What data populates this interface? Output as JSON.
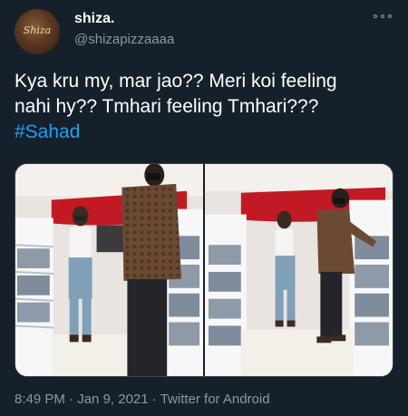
{
  "user": {
    "display_name": "shiza.",
    "handle": "@shizapizzaaaa",
    "avatar_text": "Shiza",
    "more_icon": "more-horizontal-icon"
  },
  "tweet": {
    "text_lines": [
      "Kya kru my, mar jao?? Meri koi feeling",
      "nahi hy?? Tmhari feeling Tmhari???"
    ],
    "hashtag": "#Sahad"
  },
  "media": {
    "photos": [
      {
        "description": "Man and woman standing in a store aisle, left photo"
      },
      {
        "description": "Man and woman standing in a store aisle, right photo"
      }
    ]
  },
  "meta": {
    "time": "8:49 PM",
    "separator": " · ",
    "date": "Jan 9, 2021",
    "source": "Twitter for Android"
  },
  "colors": {
    "background": "#15202b",
    "secondary_text": "#8899a6",
    "link": "#1da1f2"
  }
}
